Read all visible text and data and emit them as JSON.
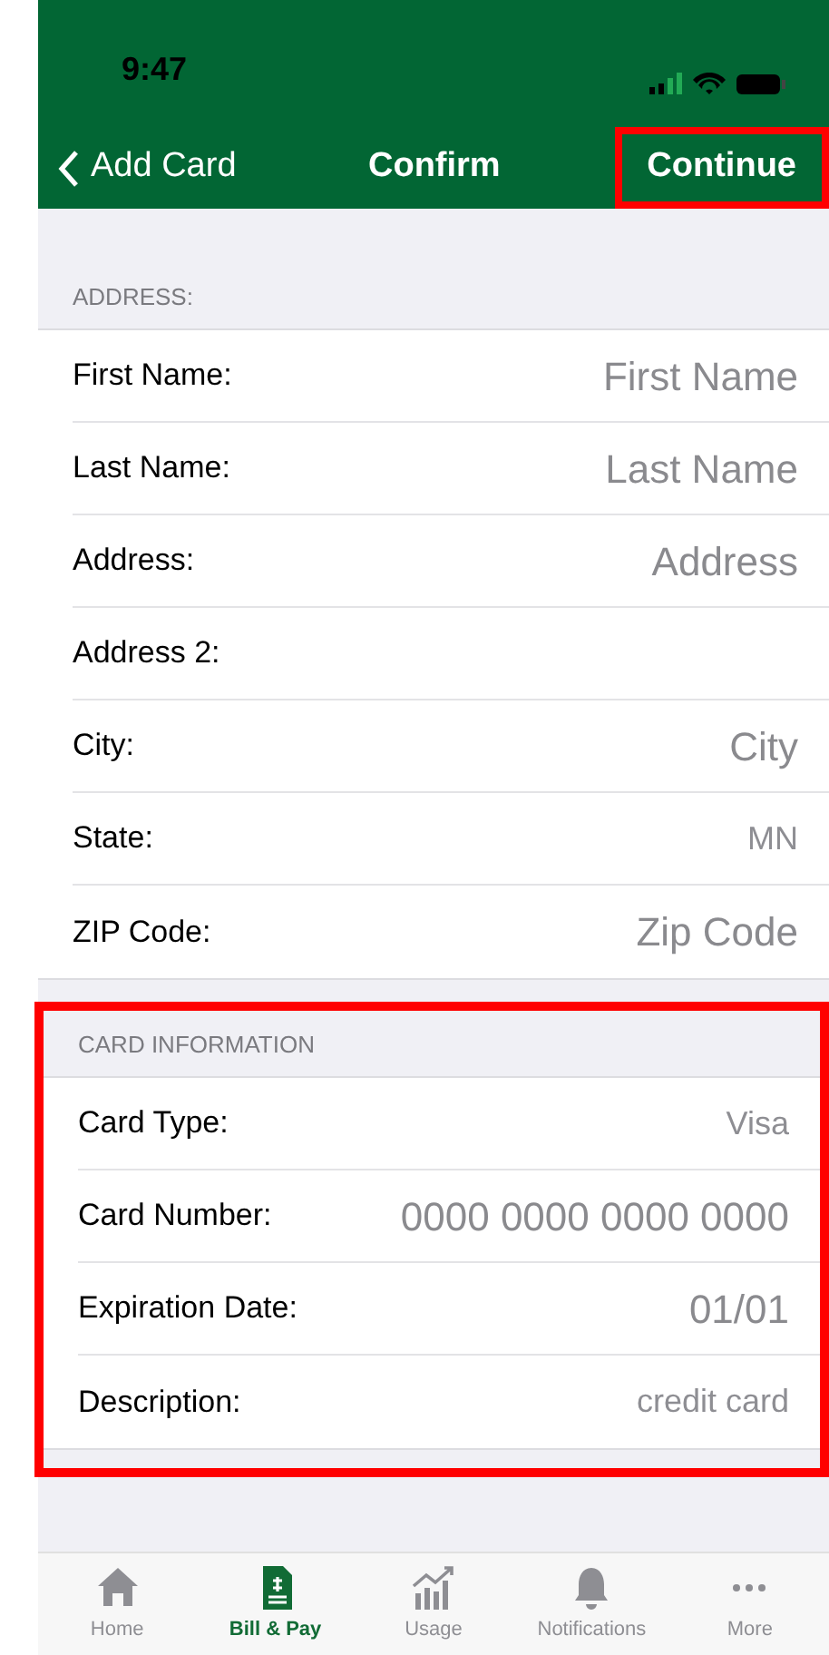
{
  "status_bar": {
    "time": "9:47"
  },
  "nav": {
    "back": "Add Card",
    "title": "Confirm",
    "action": "Continue",
    "action_highlighted": true
  },
  "sections": [
    {
      "header": "ADDRESS:",
      "highlighted": false,
      "rows": [
        {
          "label": "First Name:",
          "placeholder": "First Name"
        },
        {
          "label": "Last Name:",
          "placeholder": "Last Name"
        },
        {
          "label": "Address:",
          "placeholder": "Address"
        },
        {
          "label": "Address 2:"
        },
        {
          "label": "City:",
          "placeholder": "City"
        },
        {
          "label": "State:",
          "value": "MN"
        },
        {
          "label": "ZIP Code:",
          "placeholder": "Zip Code"
        }
      ]
    },
    {
      "header": "CARD INFORMATION",
      "highlighted": true,
      "rows": [
        {
          "label": "Card Type:",
          "value": "Visa"
        },
        {
          "label": "Card Number:",
          "placeholder": "0000 0000 0000 0000"
        },
        {
          "label": "Expiration Date:",
          "placeholder": "01/01"
        },
        {
          "label": "Description:",
          "value": "credit card"
        }
      ]
    }
  ],
  "tab_bar": [
    {
      "label": "Home",
      "kind": "home",
      "selected": false
    },
    {
      "label": "Bill & Pay",
      "kind": "bill",
      "selected": true
    },
    {
      "label": "Usage",
      "kind": "usage",
      "selected": false
    },
    {
      "label": "Notifications",
      "kind": "bell",
      "selected": false
    },
    {
      "label": "More",
      "kind": "more",
      "selected": false
    }
  ]
}
